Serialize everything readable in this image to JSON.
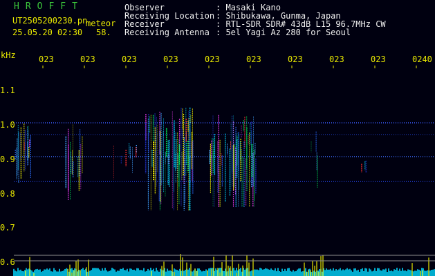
{
  "header": {
    "program": "HROFFT",
    "filename": "UT2505200230.pn",
    "tag": "meteor",
    "datetime": "25.05.20 02:30",
    "count": "58.",
    "fields": [
      {
        "label": "Observer",
        "value": ": Masaki Kano"
      },
      {
        "label": "Receiving Location",
        "value": ": Shibukawa, Gunma, Japan"
      },
      {
        "label": "Receiver",
        "value": ": RTL-SDR SDR# 43dB L15 96.7MHz CW"
      },
      {
        "label": "Receiving Antenna",
        "value": ": 5el Yagi Az 280 for Seoul"
      }
    ]
  },
  "axis": {
    "unit": "kHz",
    "y_ticks": [
      "1.1",
      "1.0",
      "0.9",
      "0.8",
      "0.7",
      "0.6"
    ],
    "x_ticks": [
      "023",
      "023",
      "023",
      "023",
      "023",
      "023",
      "023",
      "023",
      "023",
      "0240"
    ]
  },
  "colors": {
    "background": "#000010",
    "dotted": "#2a4cff",
    "yellow": "#e8e800",
    "cyan": "#00d8ff",
    "green": "#3cc83c"
  }
}
